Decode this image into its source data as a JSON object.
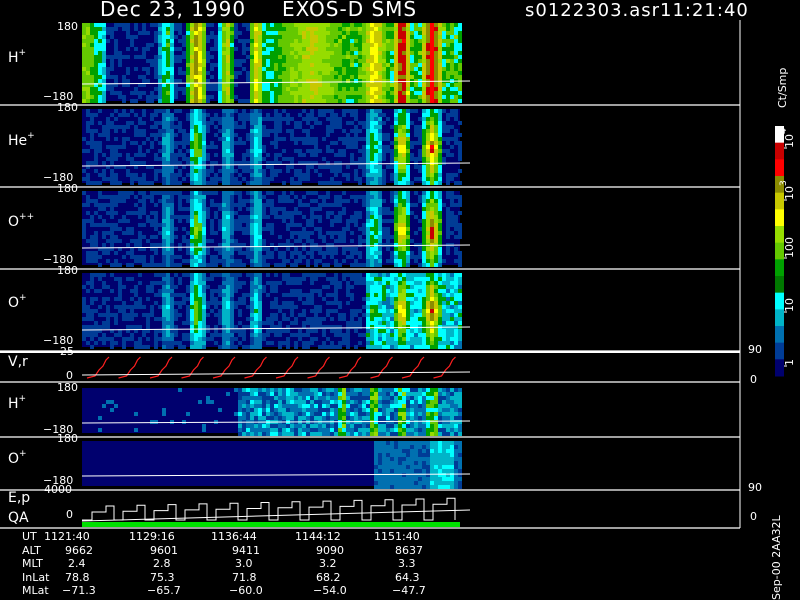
{
  "header": {
    "date": "Dec 23, 1990",
    "mission": "EXOS-D SMS",
    "file": "s0122303.asr",
    "time": "11:21:40"
  },
  "colorbar": {
    "unit": "Ct/Smp",
    "labels": [
      {
        "value": "10",
        "sup": "4"
      },
      {
        "value": "10",
        "sup": "3"
      },
      {
        "value": "100",
        "sup": ""
      },
      {
        "value": "10",
        "sup": ""
      },
      {
        "value": "1",
        "sup": ""
      }
    ],
    "colors": [
      "#ffffff",
      "#c80000",
      "#ff0000",
      "#8c8c00",
      "#c8c800",
      "#ffff00",
      "#96dc00",
      "#64c800",
      "#00a000",
      "#007800",
      "#00ffff",
      "#00b4c8",
      "#0070b0",
      "#003c96",
      "#00006e"
    ]
  },
  "panels": [
    {
      "id": "h-plus",
      "name": "H",
      "sup": "+",
      "ytop": "180",
      "ybot": "−180"
    },
    {
      "id": "he-plus",
      "name": "He",
      "sup": "+",
      "ytop": "180",
      "ybot": "−180"
    },
    {
      "id": "o-plus-plus",
      "name": "O",
      "sup": "++",
      "ytop": "180",
      "ybot": "−180"
    },
    {
      "id": "o-plus",
      "name": "O",
      "sup": "+",
      "ytop": "180",
      "ybot": "−180"
    },
    {
      "id": "vr",
      "name": "V,r",
      "sup": "",
      "ytop": "25",
      "ybot": "0",
      "rtop": "90",
      "rbot": "0"
    },
    {
      "id": "h-plus-2",
      "name": "H",
      "sup": "+",
      "ytop": "180",
      "ybot": "−180"
    },
    {
      "id": "o-plus-2",
      "name": "O",
      "sup": "+",
      "ytop": "180",
      "ybot": "−180"
    },
    {
      "id": "ep-qa",
      "name": "E,p",
      "name2": "QA",
      "sup": "",
      "ytop": "4000",
      "ybot": "0",
      "rtop": "90",
      "rbot": "0"
    }
  ],
  "chart_data": {
    "type": "heatmap",
    "title": "Dec 23, 1990   EXOS-D SMS",
    "colorbar_label": "Ct/Smp",
    "colorbar_scale": "log",
    "colorbar_range": [
      1,
      10000
    ],
    "x_axis": "UT",
    "series": [
      {
        "name": "H+",
        "ylim": [
          -180,
          180
        ]
      },
      {
        "name": "He+",
        "ylim": [
          -180,
          180
        ]
      },
      {
        "name": "O++",
        "ylim": [
          -180,
          180
        ]
      },
      {
        "name": "O+",
        "ylim": [
          -180,
          180
        ]
      },
      {
        "name": "V,r",
        "ylim": [
          0,
          25
        ],
        "right_ylim": [
          0,
          90
        ]
      },
      {
        "name": "H+",
        "ylim": [
          -180,
          180
        ]
      },
      {
        "name": "O+",
        "ylim": [
          -180,
          180
        ]
      },
      {
        "name": "E,p / QA",
        "ylim": [
          0,
          4000
        ],
        "right_ylim": [
          0,
          90
        ]
      }
    ],
    "table": {
      "rows": [
        {
          "label": "UT",
          "values": [
            "1121:40",
            "1129:16",
            "1136:44",
            "1144:12",
            "1151:40"
          ]
        },
        {
          "label": "ALT",
          "values": [
            "9662",
            "9601",
            "9411",
            "9090",
            "8637"
          ]
        },
        {
          "label": "MLT",
          "values": [
            "2.4",
            "2.8",
            "3.0",
            "3.2",
            "3.3"
          ]
        },
        {
          "label": "InLat",
          "values": [
            "78.8",
            "75.3",
            "71.8",
            "68.2",
            "64.3"
          ]
        },
        {
          "label": "MLat",
          "values": [
            "−71.3",
            "−65.7",
            "−60.0",
            "−54.0",
            "−47.7"
          ]
        }
      ]
    }
  },
  "footer": {
    "stamp": "Sep-00 2AA32L"
  }
}
